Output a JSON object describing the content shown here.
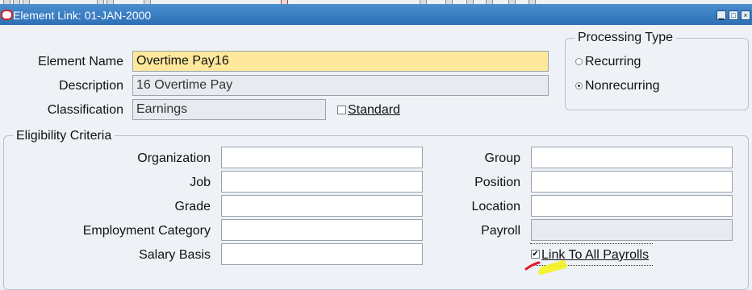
{
  "window": {
    "title": "Element Link: 01-JAN-2000",
    "minimize_label": "▁",
    "maximize_label": "□",
    "close_label": "×"
  },
  "form": {
    "element_name_label": "Element Name",
    "element_name_value": "Overtime Pay16",
    "description_label": "Description",
    "description_value": "16 Overtime Pay",
    "classification_label": "Classification",
    "classification_value": "Earnings",
    "standard_label": "Standard"
  },
  "processing_type": {
    "legend": "Processing Type",
    "recurring": "Recurring",
    "nonrecurring": "Nonrecurring",
    "selected": "Nonrecurring"
  },
  "eligibility": {
    "legend": "Eligibility Criteria",
    "organization_label": "Organization",
    "job_label": "Job",
    "grade_label": "Grade",
    "employment_category_label": "Employment Category",
    "salary_basis_label": "Salary Basis",
    "group_label": "Group",
    "position_label": "Position",
    "location_label": "Location",
    "payroll_label": "Payroll",
    "link_all_payrolls_label": "Link To All Payrolls",
    "link_all_payrolls_checked": true,
    "checkmark": "✔"
  },
  "annotation": {
    "red_mark_color": "#e0202a",
    "yellow_highlight_color": "#f5f21c"
  }
}
